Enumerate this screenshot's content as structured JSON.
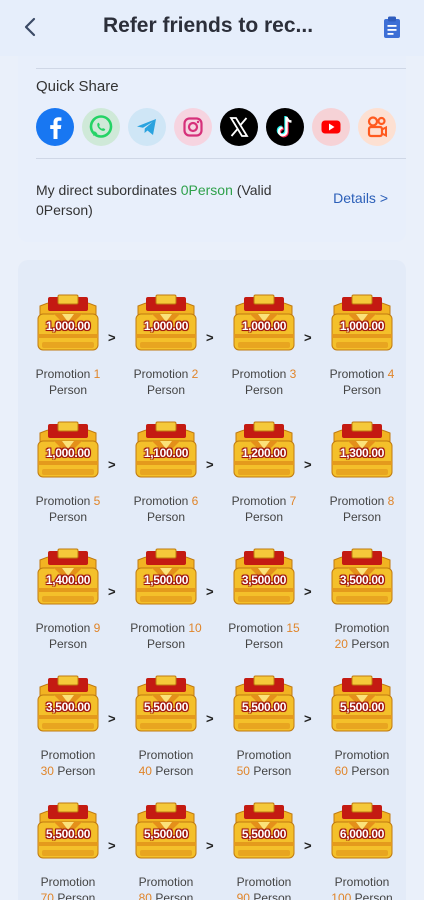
{
  "header": {
    "title": "Refer friends to rec..."
  },
  "quick_share": {
    "label": "Quick Share",
    "icons": [
      {
        "name": "facebook-icon",
        "color": "#1877f2"
      },
      {
        "name": "whatsapp-icon",
        "color": "#25d366"
      },
      {
        "name": "telegram-icon",
        "color": "#2aa3df"
      },
      {
        "name": "instagram-icon",
        "color": "#d6307a"
      },
      {
        "name": "x-icon",
        "color": "#000000"
      },
      {
        "name": "tiktok-icon",
        "color": "#000000"
      },
      {
        "name": "youtube-icon",
        "color": "#ff0000"
      },
      {
        "name": "kwai-icon",
        "color": "#ff5a1f"
      }
    ]
  },
  "subordinates": {
    "prefix": "My direct subordinates ",
    "count": "0Person",
    "valid": " (Valid 0Person)",
    "details_label": "Details >"
  },
  "rewards": [
    {
      "amount": "1,000.00",
      "label": "Promotion",
      "count": "1",
      "unit": "Person"
    },
    {
      "amount": "1,000.00",
      "label": "Promotion",
      "count": "2",
      "unit": "Person"
    },
    {
      "amount": "1,000.00",
      "label": "Promotion",
      "count": "3",
      "unit": "Person"
    },
    {
      "amount": "1,000.00",
      "label": "Promotion",
      "count": "4",
      "unit": "Person"
    },
    {
      "amount": "1,000.00",
      "label": "Promotion",
      "count": "5",
      "unit": "Person"
    },
    {
      "amount": "1,100.00",
      "label": "Promotion",
      "count": "6",
      "unit": "Person"
    },
    {
      "amount": "1,200.00",
      "label": "Promotion",
      "count": "7",
      "unit": "Person"
    },
    {
      "amount": "1,300.00",
      "label": "Promotion",
      "count": "8",
      "unit": "Person"
    },
    {
      "amount": "1,400.00",
      "label": "Promotion",
      "count": "9",
      "unit": "Person"
    },
    {
      "amount": "1,500.00",
      "label": "Promotion",
      "count": "10",
      "unit": "Person"
    },
    {
      "amount": "3,500.00",
      "label": "Promotion",
      "count": "15",
      "unit": "Person"
    },
    {
      "amount": "3,500.00",
      "label": "Promotion",
      "count": "20",
      "unit": "Person"
    },
    {
      "amount": "3,500.00",
      "label": "Promotion",
      "count": "30",
      "unit": "Person"
    },
    {
      "amount": "5,500.00",
      "label": "Promotion",
      "count": "40",
      "unit": "Person"
    },
    {
      "amount": "5,500.00",
      "label": "Promotion",
      "count": "50",
      "unit": "Person"
    },
    {
      "amount": "5,500.00",
      "label": "Promotion",
      "count": "60",
      "unit": "Person"
    },
    {
      "amount": "5,500.00",
      "label": "Promotion",
      "count": "70",
      "unit": "Person"
    },
    {
      "amount": "5,500.00",
      "label": "Promotion",
      "count": "80",
      "unit": "Person"
    },
    {
      "amount": "5,500.00",
      "label": "Promotion",
      "count": "90",
      "unit": "Person"
    },
    {
      "amount": "6,000.00",
      "label": "Promotion",
      "count": "100",
      "unit": "Person"
    }
  ],
  "separator": ">",
  "colors": {
    "accent_orange": "#e0852a",
    "accent_green": "#2fa14b",
    "link_blue": "#2b5fb8"
  }
}
